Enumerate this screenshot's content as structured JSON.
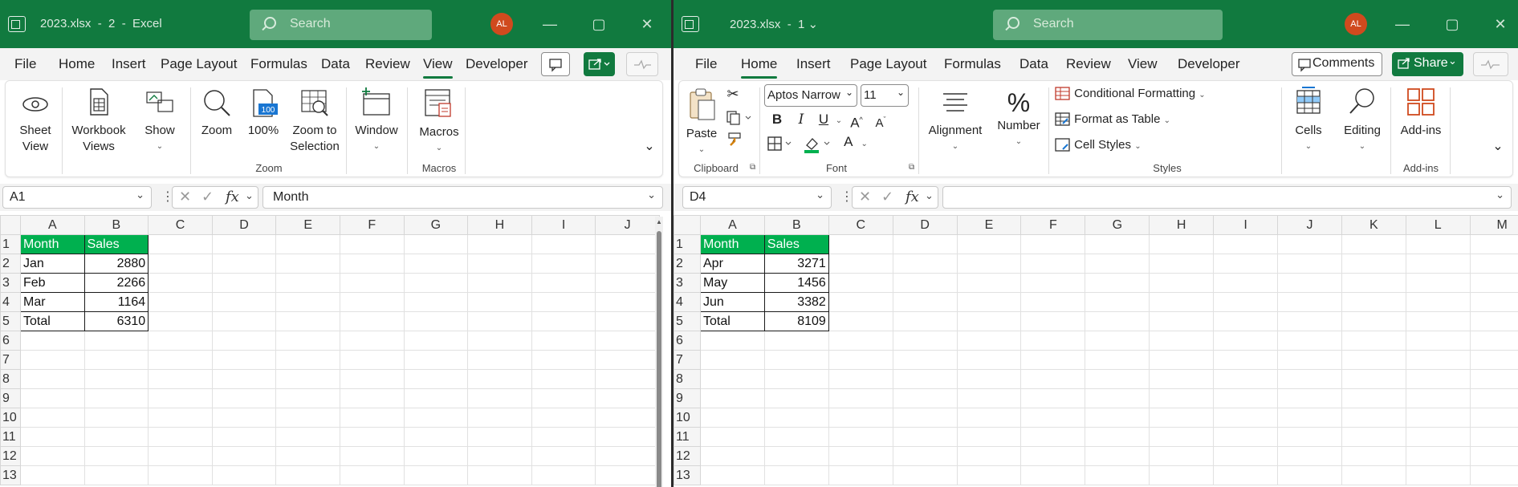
{
  "left": {
    "title": "2023.xlsx  -  2  -  Excel",
    "search_placeholder": "Search",
    "avatar": "AL",
    "tabs": [
      "File",
      "Home",
      "Insert",
      "Page Layout",
      "Formulas",
      "Data",
      "Review",
      "View",
      "Developer"
    ],
    "active_tab": "View",
    "ribbon": {
      "sheet_view": "Sheet View",
      "workbook_views": "Workbook Views",
      "show": "Show",
      "zoom": "Zoom",
      "zoom100": "100%",
      "zoom_to_selection": "Zoom to Selection",
      "window": "Window",
      "macros": "Macros",
      "group_zoom": "Zoom",
      "group_macros": "Macros"
    },
    "namebox": "A1",
    "formula": "Month",
    "columns": [
      "A",
      "B",
      "C",
      "D",
      "E",
      "F",
      "G",
      "H",
      "I",
      "J"
    ],
    "rows": [
      [
        "Month",
        "Sales"
      ],
      [
        "Jan",
        "2880"
      ],
      [
        "Feb",
        "2266"
      ],
      [
        "Mar",
        "1164"
      ],
      [
        "Total",
        "6310"
      ]
    ],
    "row_numbers": [
      "1",
      "2",
      "3",
      "4",
      "5",
      "6",
      "7",
      "8",
      "9",
      "10",
      "11",
      "12",
      "13"
    ]
  },
  "right": {
    "title": "2023.xlsx  -  1 ⌄",
    "search_placeholder": "Search",
    "avatar": "AL",
    "tabs": [
      "File",
      "Home",
      "Insert",
      "Page Layout",
      "Formulas",
      "Data",
      "Review",
      "View",
      "Developer"
    ],
    "active_tab": "Home",
    "comments": "Comments",
    "share": "Share",
    "ribbon": {
      "paste": "Paste",
      "font_name": "Aptos Narrow",
      "font_size": "11",
      "alignment": "Alignment",
      "number": "Number",
      "conditional_formatting": "Conditional Formatting",
      "format_as_table": "Format as Table",
      "cell_styles": "Cell Styles",
      "cells": "Cells",
      "editing": "Editing",
      "addins": "Add-ins",
      "group_clipboard": "Clipboard",
      "group_font": "Font",
      "group_styles": "Styles",
      "group_addins": "Add-ins",
      "bold": "B",
      "italic": "I",
      "underline": "U"
    },
    "namebox": "D4",
    "formula": "",
    "columns": [
      "A",
      "B",
      "C",
      "D",
      "E",
      "F",
      "G",
      "H",
      "I",
      "J",
      "K",
      "L",
      "M"
    ],
    "rows": [
      [
        "Month",
        "Sales"
      ],
      [
        "Apr",
        "3271"
      ],
      [
        "May",
        "1456"
      ],
      [
        "Jun",
        "3382"
      ],
      [
        "Total",
        "8109"
      ]
    ],
    "row_numbers": [
      "1",
      "2",
      "3",
      "4",
      "5",
      "6",
      "7",
      "8",
      "9",
      "10",
      "11",
      "12",
      "13"
    ]
  },
  "colors": {
    "title_bar": "#117a3f",
    "header_fill": "#00b04f",
    "avatar": "#d04a1e"
  }
}
